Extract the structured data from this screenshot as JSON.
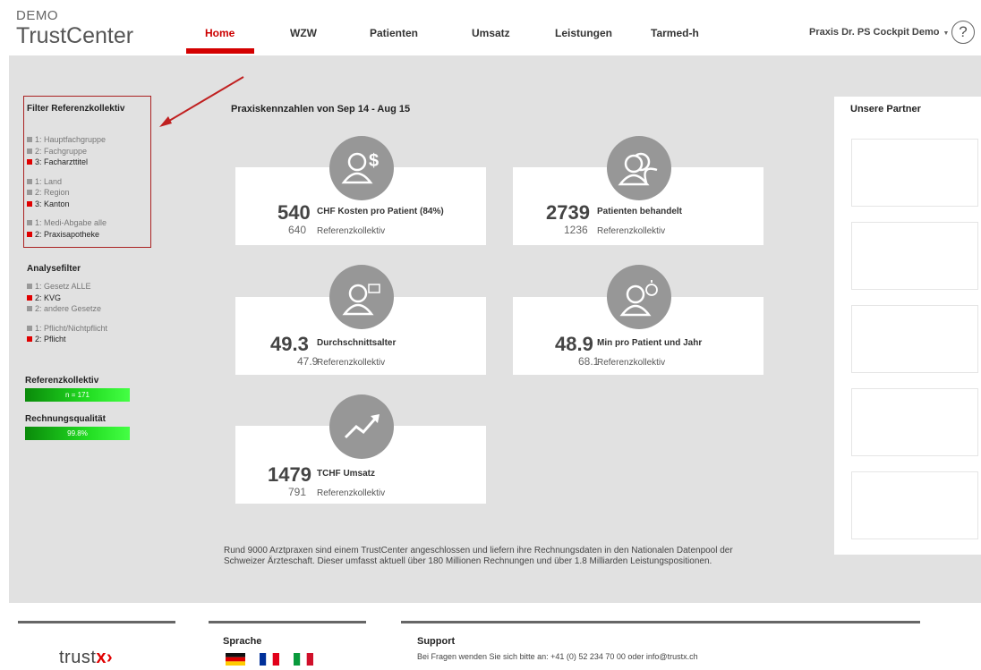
{
  "header": {
    "logo_small": "DEMO",
    "logo_big": "TrustCenter",
    "nav": [
      "Home",
      "WZW",
      "Patienten",
      "Umsatz",
      "Leistungen",
      "Tarmed-h"
    ],
    "active_tab": "Home",
    "user_menu": "Praxis Dr. PS Cockpit Demo",
    "help": "?"
  },
  "filter": {
    "title": "Filter Referenzkollektiv",
    "groups": [
      [
        {
          "label": "1: Hauptfachgruppe",
          "selected": false
        },
        {
          "label": "2: Fachgruppe",
          "selected": false
        },
        {
          "label": "3: Facharzttitel",
          "selected": true
        }
      ],
      [
        {
          "label": "1: Land",
          "selected": false
        },
        {
          "label": "2: Region",
          "selected": false
        },
        {
          "label": "3: Kanton",
          "selected": true
        }
      ],
      [
        {
          "label": "1: Medi-Abgabe alle",
          "selected": false
        },
        {
          "label": "2: Praxisapotheke",
          "selected": true
        }
      ]
    ]
  },
  "analysis": {
    "title": "Analysefilter",
    "groups": [
      [
        {
          "label": "1: Gesetz ALLE",
          "selected": false
        },
        {
          "label": "2: KVG",
          "selected": true
        },
        {
          "label": "2: andere Gesetze",
          "selected": false
        }
      ],
      [
        {
          "label": "1: Pflicht/Nichtpflicht",
          "selected": false
        },
        {
          "label": "2: Pflicht",
          "selected": true
        }
      ]
    ]
  },
  "referenzkollektiv": {
    "title": "Referenzkollektiv",
    "value": "n = 171"
  },
  "rechnungsqualitaet": {
    "title": "Rechnungsqualität",
    "value": "99.8%"
  },
  "kpi_section_title": "Praxiskennzahlen von Sep 14 - Aug 15",
  "kpis": [
    {
      "icon": "person-dollar-icon",
      "value": "540",
      "label": "CHF Kosten pro Patient (84%)",
      "ref_value": "640",
      "ref_label": "Referenzkollektiv"
    },
    {
      "icon": "two-persons-icon",
      "value": "2739",
      "label": "Patienten behandelt",
      "ref_value": "1236",
      "ref_label": "Referenzkollektiv"
    },
    {
      "icon": "person-calendar-icon",
      "value": "49.3",
      "label": "Durchschnittsalter",
      "ref_value": "47.9",
      "ref_label": "Referenzkollektiv"
    },
    {
      "icon": "person-stopwatch-icon",
      "value": "48.9",
      "label": "Min pro Patient und Jahr",
      "ref_value": "68.1",
      "ref_label": "Referenzkollektiv"
    },
    {
      "icon": "trend-up-icon",
      "value": "1479",
      "label": "TCHF Umsatz",
      "ref_value": "791",
      "ref_label": "Referenzkollektiv"
    }
  ],
  "info_text": "Rund 9000 Arztpraxen sind einem TrustCenter angeschlossen und liefern ihre Rechnungsdaten in den Nationalen Datenpool der Schweizer Ärzteschaft. Dieser umfasst aktuell über 180 Millionen Rechnungen und über 1.8 Milliarden Leistungspositionen.",
  "partner": {
    "title": "Unsere Partner"
  },
  "footer": {
    "logo_text": "trust",
    "logo_x": "x",
    "logo_arrow": "›",
    "sprache_title": "Sprache",
    "support_title": "Support",
    "support_text": "Bei Fragen wenden Sie sich bitte an: +41 (0) 52 234 70 00 oder info@trustx.ch",
    "flags": [
      "flag-de-icon",
      "flag-fr-icon",
      "flag-it-icon"
    ]
  }
}
